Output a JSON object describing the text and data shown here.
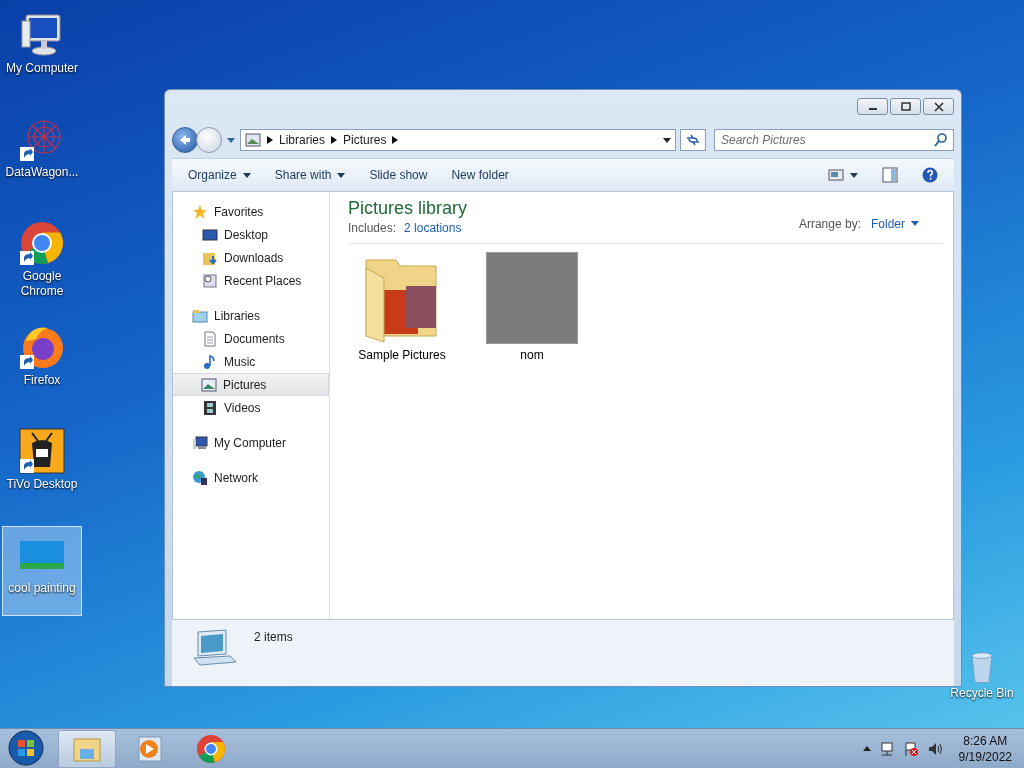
{
  "desktop_icons": [
    {
      "label": "My Computer",
      "kind": "computer",
      "shortcut": false,
      "selected": false
    },
    {
      "label": "DataWagon...",
      "kind": "datawagon",
      "shortcut": true,
      "selected": false
    },
    {
      "label": "Google Chrome",
      "kind": "chrome",
      "shortcut": true,
      "selected": false
    },
    {
      "label": "Firefox",
      "kind": "firefox",
      "shortcut": true,
      "selected": false
    },
    {
      "label": "TiVo Desktop",
      "kind": "tivo",
      "shortcut": true,
      "selected": false
    },
    {
      "label": "cool painting",
      "kind": "painting",
      "shortcut": false,
      "selected": true
    }
  ],
  "recycle_bin": {
    "label": "Recycle Bin"
  },
  "window": {
    "address": {
      "path": [
        "Libraries",
        "Pictures"
      ]
    },
    "search": {
      "placeholder": "Search Pictures"
    },
    "toolbar": [
      {
        "label": "Organize",
        "dropdown": true
      },
      {
        "label": "Share with",
        "dropdown": true
      },
      {
        "label": "Slide show",
        "dropdown": false
      },
      {
        "label": "New folder",
        "dropdown": false
      }
    ],
    "sidebar": [
      {
        "label": "Favorites",
        "kind": "star",
        "children": [
          {
            "label": "Desktop",
            "kind": "desktop",
            "selected": false
          },
          {
            "label": "Downloads",
            "kind": "downloads",
            "selected": false
          },
          {
            "label": "Recent Places",
            "kind": "recent",
            "selected": false
          }
        ]
      },
      {
        "label": "Libraries",
        "kind": "library",
        "children": [
          {
            "label": "Documents",
            "kind": "documents",
            "selected": false
          },
          {
            "label": "Music",
            "kind": "music",
            "selected": false
          },
          {
            "label": "Pictures",
            "kind": "pictures",
            "selected": true
          },
          {
            "label": "Videos",
            "kind": "videos",
            "selected": false
          }
        ]
      },
      {
        "label": "My Computer",
        "kind": "computer"
      },
      {
        "label": "Network",
        "kind": "network"
      }
    ],
    "library": {
      "title": "Pictures library",
      "includes_label": "Includes:",
      "includes_link": "2 locations",
      "arrange_label": "Arrange by:",
      "arrange_value": "Folder"
    },
    "items": [
      {
        "label": "Sample Pictures",
        "kind": "folder"
      },
      {
        "label": "nom",
        "kind": "image"
      }
    ],
    "status": "2 items"
  },
  "taskbar": {
    "buttons": [
      {
        "kind": "explorer",
        "selected": true
      },
      {
        "kind": "media",
        "selected": false
      },
      {
        "kind": "chrome",
        "selected": false
      }
    ],
    "time": "8:26 AM",
    "date": "9/19/2022"
  }
}
